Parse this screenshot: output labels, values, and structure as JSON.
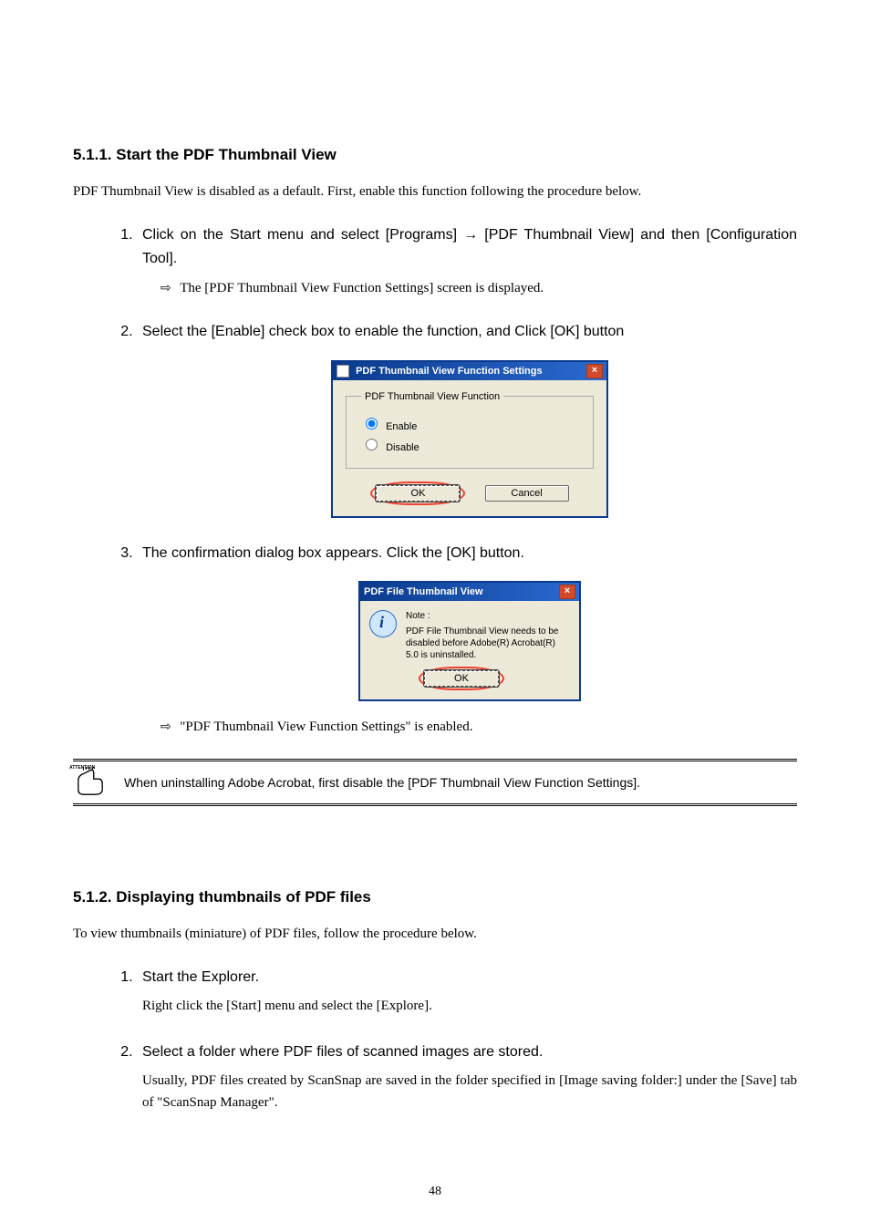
{
  "section1": {
    "heading": "5.1.1. Start the PDF Thumbnail View",
    "intro": "PDF Thumbnail View is disabled as a default. First, enable this function following the procedure below.",
    "step1": "Click on the Start menu and select [Programs] → [PDF Thumbnail View] and then [Configuration Tool].",
    "step1_sub": "The [PDF Thumbnail View Function Settings] screen is displayed.",
    "step2": "Select the [Enable] check box to enable the function, and Click [OK] button",
    "step3": "The confirmation dialog box appears. Click the [OK] button.",
    "step3_sub": "\"PDF Thumbnail View Function Settings\" is enabled."
  },
  "dialog1": {
    "title": "PDF Thumbnail View Function Settings",
    "group_label": "PDF Thumbnail View Function",
    "radio_enable": "Enable",
    "radio_disable": "Disable",
    "ok": "OK",
    "cancel": "Cancel"
  },
  "dialog2": {
    "title": "PDF File Thumbnail View",
    "note_label": "Note :",
    "note_text": "PDF File Thumbnail View needs to be disabled before Adobe(R) Acrobat(R) 5.0 is uninstalled.",
    "ok": "OK"
  },
  "attention": {
    "label": "ATTENTION",
    "text": "When uninstalling Adobe Acrobat, first disable the [PDF Thumbnail View Function Settings]."
  },
  "section2": {
    "heading": "5.1.2. Displaying thumbnails of PDF files",
    "intro": "To view thumbnails (miniature) of PDF files, follow the procedure below.",
    "step1": "Start the Explorer.",
    "step1_desc": "Right click the [Start] menu and select the [Explore].",
    "step2": "Select a folder where PDF files of scanned images are stored.",
    "step2_desc": "Usually, PDF files created by ScanSnap are saved in the folder specified in [Image saving folder:] under the [Save] tab of \"ScanSnap Manager\"."
  },
  "page_number": "48"
}
